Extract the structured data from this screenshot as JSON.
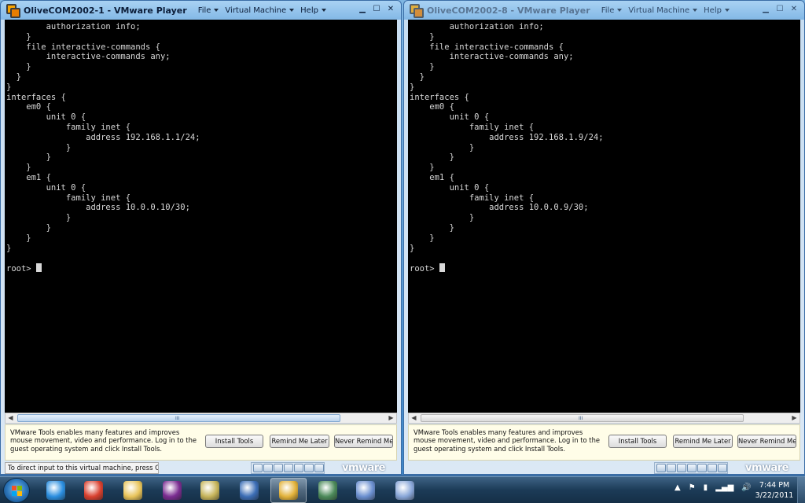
{
  "windows": {
    "left": {
      "title": "OliveCOM2002-1 - VMware Player",
      "menu": {
        "file": "File",
        "vm": "Virtual Machine",
        "help": "Help"
      },
      "console_text": "        authorization info;\n    }\n    file interactive-commands {\n        interactive-commands any;\n    }\n  }\n}\ninterfaces {\n    em0 {\n        unit 0 {\n            family inet {\n                address 192.168.1.1/24;\n            }\n        }\n    }\n    em1 {\n        unit 0 {\n            family inet {\n                address 10.0.0.10/30;\n            }\n        }\n    }\n}\n\nroot> ",
      "notify": {
        "message": "VMware Tools enables many features and improves mouse movement, video and performance. Log in to the guest operating system and click Install Tools.",
        "install": "Install Tools",
        "later": "Remind Me Later",
        "never": "Never Remind Me"
      },
      "status_text": "To direct input to this virtual machine, press Ctrl+G.",
      "brand": "vmware"
    },
    "right": {
      "title": "OliveCOM2002-8 - VMware Player",
      "menu": {
        "file": "File",
        "vm": "Virtual Machine",
        "help": "Help"
      },
      "console_text": "        authorization info;\n    }\n    file interactive-commands {\n        interactive-commands any;\n    }\n  }\n}\ninterfaces {\n    em0 {\n        unit 0 {\n            family inet {\n                address 192.168.1.9/24;\n            }\n        }\n    }\n    em1 {\n        unit 0 {\n            family inet {\n                address 10.0.0.9/30;\n            }\n        }\n    }\n}\n\nroot> ",
      "notify": {
        "message": "VMware Tools enables many features and improves mouse movement, video and performance. Log in to the guest operating system and click Install Tools.",
        "install": "Install Tools",
        "later": "Remind Me Later",
        "never": "Never Remind Me"
      },
      "status_text": "",
      "brand": "vmware"
    }
  },
  "scroll_grip": "III",
  "taskbar": {
    "apps": [
      {
        "icon": "internet-explorer-icon",
        "color": "#2a8ee0"
      },
      {
        "icon": "chrome-icon",
        "color": "#d9402f"
      },
      {
        "icon": "file-explorer-icon",
        "color": "#e8c45a"
      },
      {
        "icon": "yahoo-messenger-icon",
        "color": "#7b2c91"
      },
      {
        "icon": "notepad-icon",
        "color": "#c6b45a"
      },
      {
        "icon": "vmware-player-icon",
        "color": "#3b6db5"
      },
      {
        "icon": "vmware-player-active-icon",
        "color": "#e2b23a"
      },
      {
        "icon": "remote-desktop-icon",
        "color": "#4c8a5a"
      },
      {
        "icon": "network-tool-icon",
        "color": "#6a8fd0"
      },
      {
        "icon": "paint-icon",
        "color": "#88a6d8"
      }
    ],
    "tray": {
      "up_arrow": "▲",
      "flag": "⚑",
      "battery": "▮",
      "signal": "▂▄▆",
      "volume": "🔊"
    },
    "time": "7:44 PM",
    "date": "3/22/2011"
  }
}
